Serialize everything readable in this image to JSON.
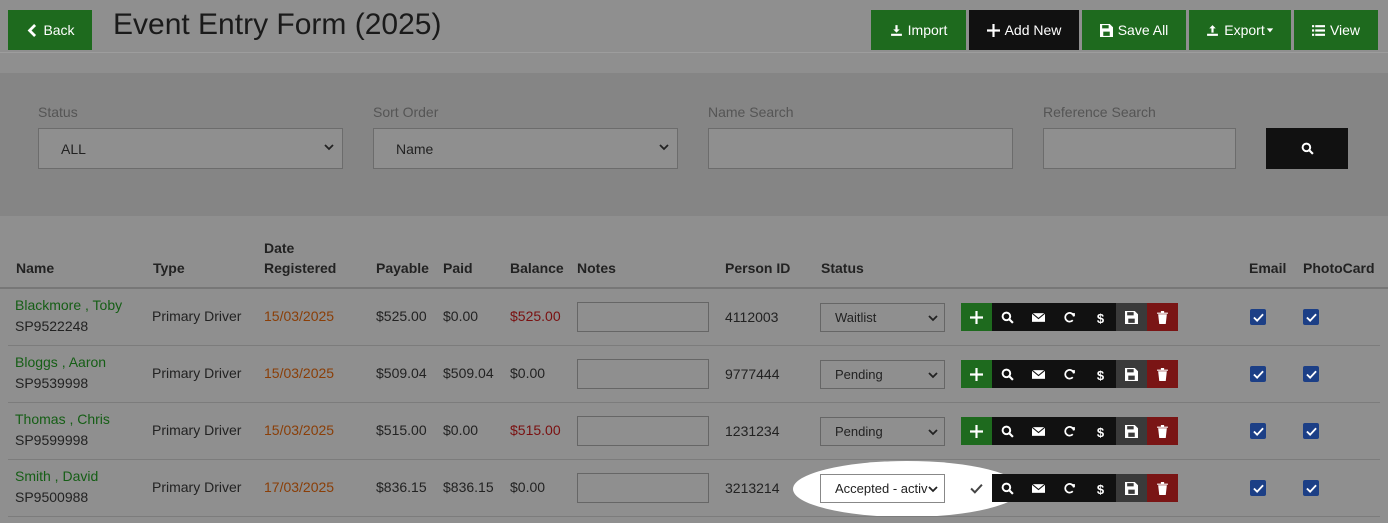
{
  "header": {
    "back_label": "Back",
    "title": "Event Entry Form (2025)",
    "import_label": "Import",
    "add_new_label": "Add New",
    "save_all_label": "Save All",
    "export_label": "Export",
    "view_label": "View"
  },
  "filters": {
    "status_label": "Status",
    "status_value": "ALL",
    "sort_label": "Sort Order",
    "sort_value": "Name",
    "name_search_label": "Name Search",
    "name_search_value": "",
    "ref_search_label": "Reference Search",
    "ref_search_value": ""
  },
  "table": {
    "headers": {
      "name": "Name",
      "type": "Type",
      "date_registered_1": "Date",
      "date_registered_2": "Registered",
      "payable": "Payable",
      "paid": "Paid",
      "balance": "Balance",
      "notes": "Notes",
      "person_id": "Person ID",
      "status": "Status",
      "email": "Email",
      "photocard": "PhotoCard"
    },
    "rows": [
      {
        "name": "Blackmore , Toby",
        "ref": "SP9522248",
        "type": "Primary Driver",
        "date": "15/03/2025",
        "payable": "$525.00",
        "paid": "$0.00",
        "balance": "$525.00",
        "notes": "",
        "person_id": "4112003",
        "status": "Waitlist"
      },
      {
        "name": "Bloggs , Aaron",
        "ref": "SP9539998",
        "type": "Primary Driver",
        "date": "15/03/2025",
        "payable": "$509.04",
        "paid": "$509.04",
        "balance": "$0.00",
        "notes": "",
        "person_id": "9777444",
        "status": "Pending"
      },
      {
        "name": "Thomas , Chris",
        "ref": "SP9599998",
        "type": "Primary Driver",
        "date": "15/03/2025",
        "payable": "$515.00",
        "paid": "$0.00",
        "balance": "$515.00",
        "notes": "",
        "person_id": "1231234",
        "status": "Pending"
      },
      {
        "name": "Smith , David",
        "ref": "SP9500988",
        "type": "Primary Driver",
        "date": "17/03/2025",
        "payable": "$836.15",
        "paid": "$836.15",
        "balance": "$0.00",
        "notes": "",
        "person_id": "3213214",
        "status": "Accepted - activ"
      }
    ]
  },
  "colors": {
    "green": "#1e6a1e",
    "black": "#111111",
    "red": "#7a1515",
    "checkbox": "#1c3f86"
  }
}
